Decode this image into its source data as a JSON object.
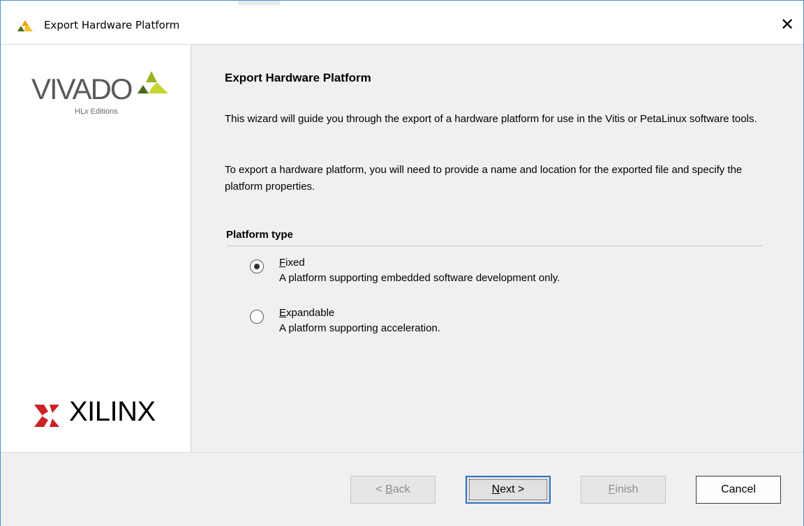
{
  "window": {
    "title": "Export Hardware Platform",
    "close_glyph": "✕",
    "title_icon": "xilinx-vivado-icon"
  },
  "branding": {
    "vivado_word": "VIVADO",
    "vivado_trademark": ".",
    "vivado_subtitle_hl": "HL",
    "vivado_subtitle_x": "x",
    "vivado_subtitle_rest": " Editions",
    "xilinx_word": "XILINX",
    "xilinx_suffix": ".",
    "colors": {
      "vivado_mark_dark": "#4a6b1a",
      "vivado_mark_light": "#c6d632",
      "xilinx_red": "#cc2127"
    }
  },
  "page": {
    "heading": "Export Hardware Platform",
    "paragraph_1": "This wizard will guide you through the export of a hardware platform for use in the Vitis or PetaLinux software tools.",
    "paragraph_2": "To export a hardware platform, you will need to provide a name and location for the exported file and specify the platform properties."
  },
  "platform_type": {
    "section_title": "Platform type",
    "selected": "Fixed",
    "options": [
      {
        "mnemonic": "F",
        "label_rest": "ixed",
        "description": "A platform supporting embedded software development only.",
        "checked": true
      },
      {
        "mnemonic": "E",
        "label_rest": "xpandable",
        "description": "A platform supporting acceleration.",
        "checked": false
      }
    ]
  },
  "footer": {
    "back": {
      "prefix": "< ",
      "mnemonic": "B",
      "rest": "ack",
      "enabled": false
    },
    "next": {
      "mnemonic": "N",
      "rest": "ext >",
      "enabled": true
    },
    "finish": {
      "mnemonic": "F",
      "rest": "inish",
      "enabled": false
    },
    "cancel": {
      "label": "Cancel",
      "enabled": true
    }
  }
}
